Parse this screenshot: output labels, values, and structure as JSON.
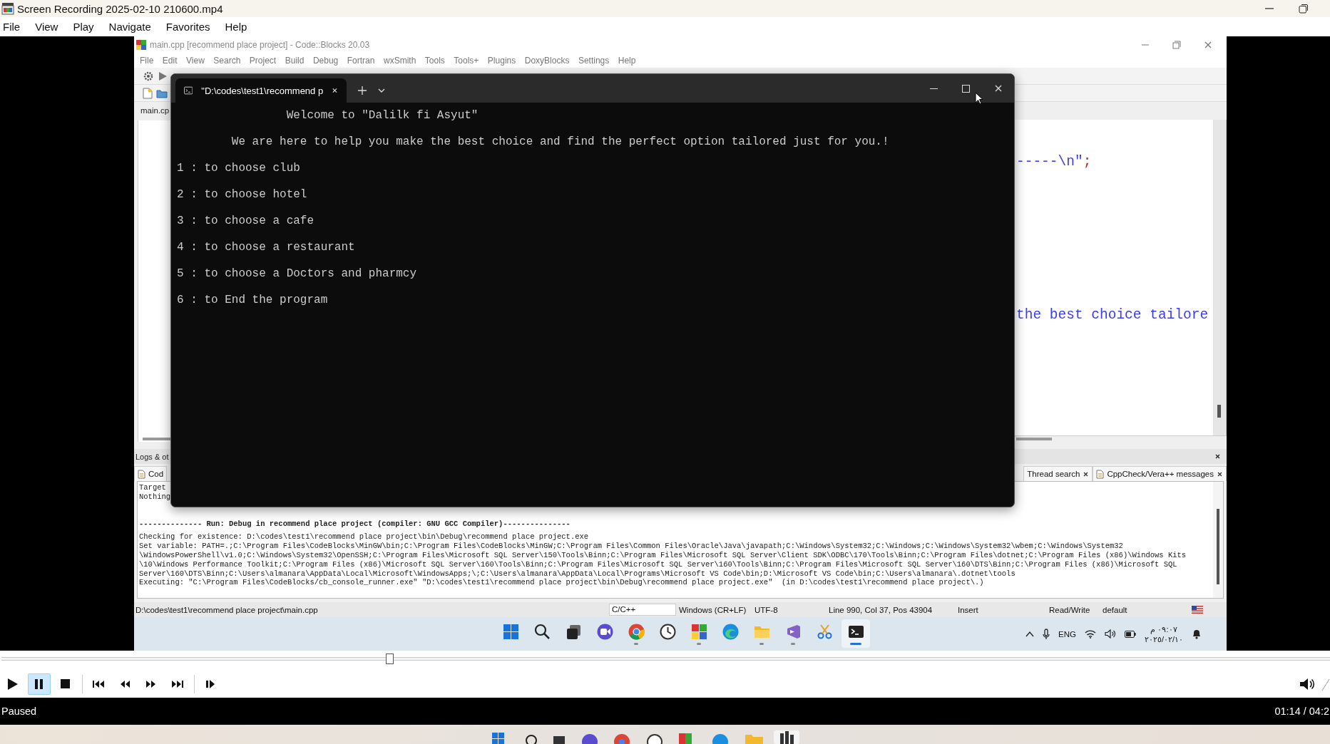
{
  "window": {
    "title": "Screen Recording 2025-02-10 210600.mp4"
  },
  "menu": [
    "File",
    "View",
    "Play",
    "Navigate",
    "Favorites",
    "Help"
  ],
  "recording": {
    "codeblocks": {
      "title": "main.cpp [recommend place project] - Code::Blocks 20.03",
      "menu": [
        "File",
        "Edit",
        "View",
        "Search",
        "Project",
        "Build",
        "Debug",
        "Fortran",
        "wxSmith",
        "Tools",
        "Tools+",
        "Plugins",
        "DoxyBlocks",
        "Settings",
        "Help"
      ],
      "editor_tab": "main.cp",
      "code_fragments": [
        {
          "string": "-----\\n\"",
          "punct": ";"
        },
        {
          "string": "the best choice tailore"
        }
      ],
      "logs": {
        "title": "Logs & ot",
        "tabs": [
          {
            "label": "Cod",
            "closable": false
          },
          {
            "label": "Thread search",
            "closable": true
          },
          {
            "label": "CppCheck/Vera++ messages",
            "closable": true
          }
        ],
        "partial_lines": [
          "Target",
          "Nothing"
        ],
        "lines": [
          {
            "kind": "header",
            "text": "-------------- Run: Debug in recommend place project (compiler: GNU GCC Compiler)---------------"
          },
          {
            "kind": "plain",
            "text": "Checking for existence: D:\\codes\\test1\\recommend place project\\bin\\Debug\\recommend place project.exe"
          },
          {
            "kind": "plain",
            "text": "Set variable: PATH=.;C:\\Program Files\\CodeBlocks\\MinGW\\bin;C:\\Program Files\\CodeBlocks\\MinGW;C:\\Program Files\\Common Files\\Oracle\\Java\\javapath;C:\\Windows\\System32;C:\\Windows;C:\\Windows\\System32\\wbem;C:\\Windows\\System32"
          },
          {
            "kind": "plain",
            "text": "\\WindowsPowerShell\\v1.0;C:\\Windows\\System32\\OpenSSH;C:\\Program Files\\Microsoft SQL Server\\150\\Tools\\Binn;C:\\Program Files\\Microsoft SQL Server\\Client SDK\\ODBC\\170\\Tools\\Binn;C:\\Program Files\\dotnet;C:\\Program Files (x86)\\Windows Kits"
          },
          {
            "kind": "plain",
            "text": "\\10\\Windows Performance Toolkit;C:\\Program Files (x86)\\Microsoft SQL Server\\160\\Tools\\Binn;C:\\Program Files\\Microsoft SQL Server\\160\\Tools\\Binn;C:\\Program Files\\Microsoft SQL Server\\160\\DTS\\Binn;C:\\Program Files (x86)\\Microsoft SQL"
          },
          {
            "kind": "plain",
            "text": "Server\\160\\DTS\\Binn;C:\\Users\\almanara\\AppData\\Local\\Microsoft\\WindowsApps;\\;C:\\Users\\almanara\\AppData\\Local\\Programs\\Microsoft VS Code\\bin;D:\\Microsoft VS Code\\bin;C:\\Users\\almanara\\.dotnet\\tools"
          },
          {
            "kind": "plain",
            "text": "Executing: \"C:\\Program Files\\CodeBlocks/cb_console_runner.exe\" \"D:\\codes\\test1\\recommend place project\\bin\\Debug\\recommend place project.exe\"  (in D:\\codes\\test1\\recommend place project\\.)"
          }
        ]
      },
      "status_bar": {
        "path": "D:\\codes\\test1\\recommend place project\\main.cpp",
        "language": "C/C++",
        "line_endings": "Windows (CR+LF)",
        "encoding": "UTF-8",
        "position": "Line 990, Col 37, Pos 43904",
        "mode": "Insert",
        "access": "Read/Write",
        "theme": "default"
      }
    },
    "taskbar": {
      "apps": [
        {
          "kind": "start",
          "running": false,
          "active": false
        },
        {
          "kind": "search",
          "running": false,
          "active": false
        },
        {
          "kind": "taskview",
          "running": false,
          "active": false
        },
        {
          "kind": "meet",
          "running": false,
          "active": false
        },
        {
          "kind": "chrome",
          "running": true,
          "active": false
        },
        {
          "kind": "clock",
          "running": false,
          "active": false
        },
        {
          "kind": "blocks",
          "running": true,
          "active": false
        },
        {
          "kind": "edge",
          "running": false,
          "active": false
        },
        {
          "kind": "folder",
          "running": true,
          "active": false
        },
        {
          "kind": "studio",
          "running": true,
          "active": false
        },
        {
          "kind": "snip",
          "running": false,
          "active": false
        },
        {
          "kind": "terminal",
          "running": true,
          "active": true
        }
      ],
      "language": "ENG",
      "time": "٠٩:٠٧ م",
      "date": "٢٠٢٥/٠٢/١٠"
    },
    "console": {
      "tab_title": "\"D:\\codes\\test1\\recommend p",
      "lines": [
        {
          "kind": "title",
          "text": "Welcome to \"Dalilk fi Asyut\""
        },
        {
          "kind": "subtitle",
          "text": "We are here to help you make the best choice and find the perfect option tailored just for you.!"
        },
        {
          "kind": "option",
          "text": "1 : to choose club"
        },
        {
          "kind": "option",
          "text": "2 : to choose hotel"
        },
        {
          "kind": "option",
          "text": "3 : to choose a cafe"
        },
        {
          "kind": "option",
          "text": "4 : to choose a restaurant"
        },
        {
          "kind": "option",
          "text": "5 : to choose a Doctors and pharmcy"
        },
        {
          "kind": "option",
          "text": "6 : to End the program"
        }
      ]
    }
  },
  "player": {
    "seek": {
      "level": 0.292
    },
    "controls": [
      {
        "kind": "play",
        "selected": false
      },
      {
        "kind": "pause",
        "selected": true
      },
      {
        "kind": "stop",
        "selected": false
      },
      {
        "kind": "previous",
        "selected": false
      },
      {
        "kind": "rewind",
        "selected": false
      },
      {
        "kind": "forward",
        "selected": false
      },
      {
        "kind": "next",
        "selected": false
      },
      {
        "kind": "frame_step",
        "selected": false
      }
    ],
    "status": "Paused",
    "time": "01:14 / 04:2"
  }
}
